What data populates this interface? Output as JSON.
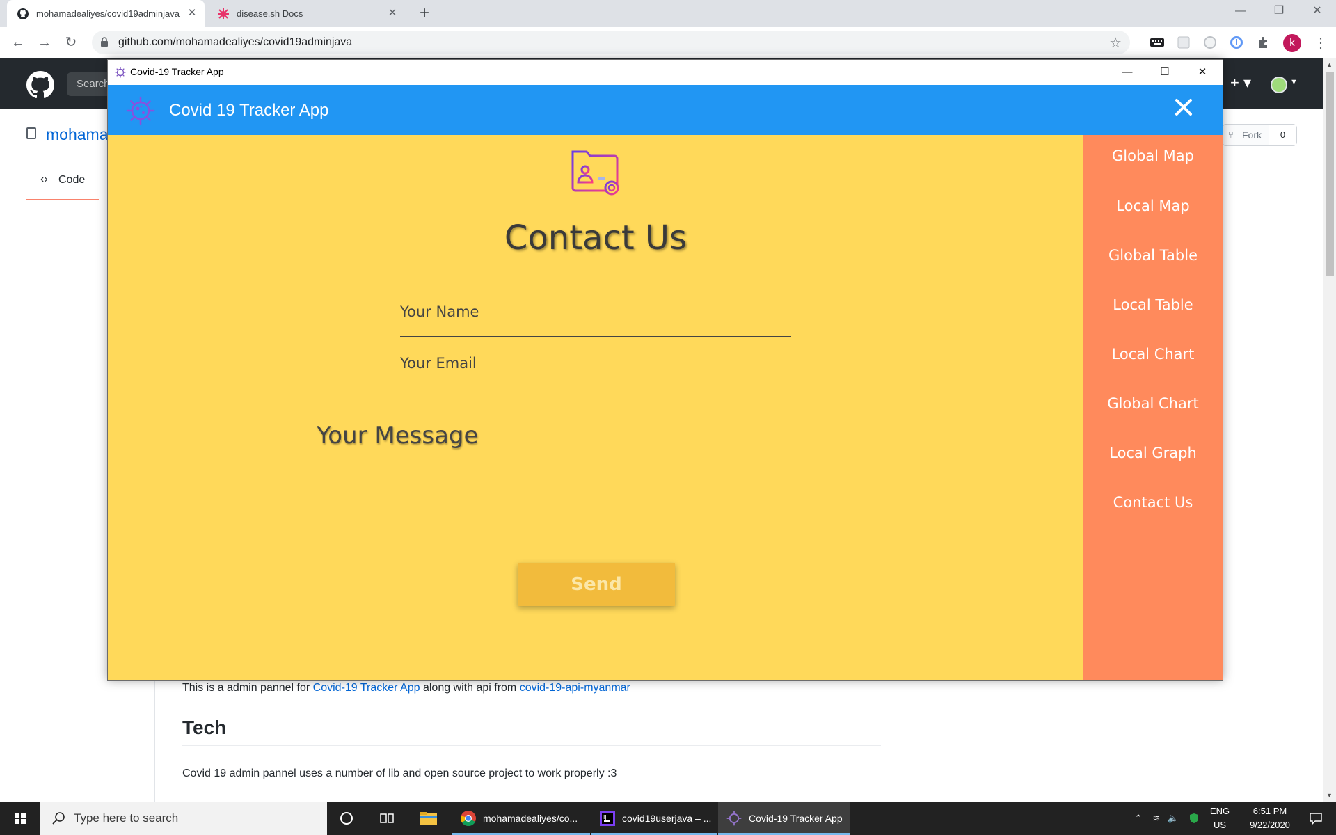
{
  "browser": {
    "tabs": [
      {
        "title": "mohamadealiyes/covid19adminjava",
        "active": true
      },
      {
        "title": "disease.sh Docs",
        "active": false
      }
    ],
    "url": "github.com/mohamadealiyes/covid19adminjava",
    "profile_initial": "k"
  },
  "github": {
    "search_placeholder": "Search",
    "repo_name": "mohama",
    "fork_label": "Fork",
    "fork_count": "0",
    "code_tab": "Code",
    "readme": {
      "intro_prefix": "This is a admin pannel for ",
      "intro_link1": "Covid-19 Tracker App",
      "intro_middle": " along with api from ",
      "intro_link2": "covid-19-api-myanmar",
      "heading": "Tech",
      "description": "Covid 19 admin pannel uses a number of lib and open source project to work properly :3"
    }
  },
  "app": {
    "window_title": "Covid-19 Tracker App",
    "header_title": "Covid 19 Tracker App",
    "page_title": "Contact Us",
    "fields": {
      "name_placeholder": "Your Name",
      "email_placeholder": "Your Email",
      "message_placeholder": "Your Message"
    },
    "send_label": "Send",
    "sidebar": [
      "Global Map",
      "Local Map",
      "Global Table",
      "Local Table",
      "Local Chart",
      "Global Chart",
      "Local Graph",
      "Contact Us"
    ],
    "colors": {
      "header": "#2196f3",
      "content_bg": "#ffd95a",
      "sidebar_bg": "#ff8a5c",
      "send_button": "#f2bb3c"
    }
  },
  "taskbar": {
    "search_placeholder": "Type here to search",
    "apps": [
      {
        "label": "mohamadealiyes/co...",
        "icon": "chrome-icon"
      },
      {
        "label": "covid19userjava – ...",
        "icon": "intellij-icon"
      },
      {
        "label": "Covid-19 Tracker App",
        "icon": "covid-app-icon",
        "active": true
      }
    ],
    "language": "ENG",
    "region": "US",
    "time": "6:51 PM",
    "date": "9/22/2020"
  }
}
